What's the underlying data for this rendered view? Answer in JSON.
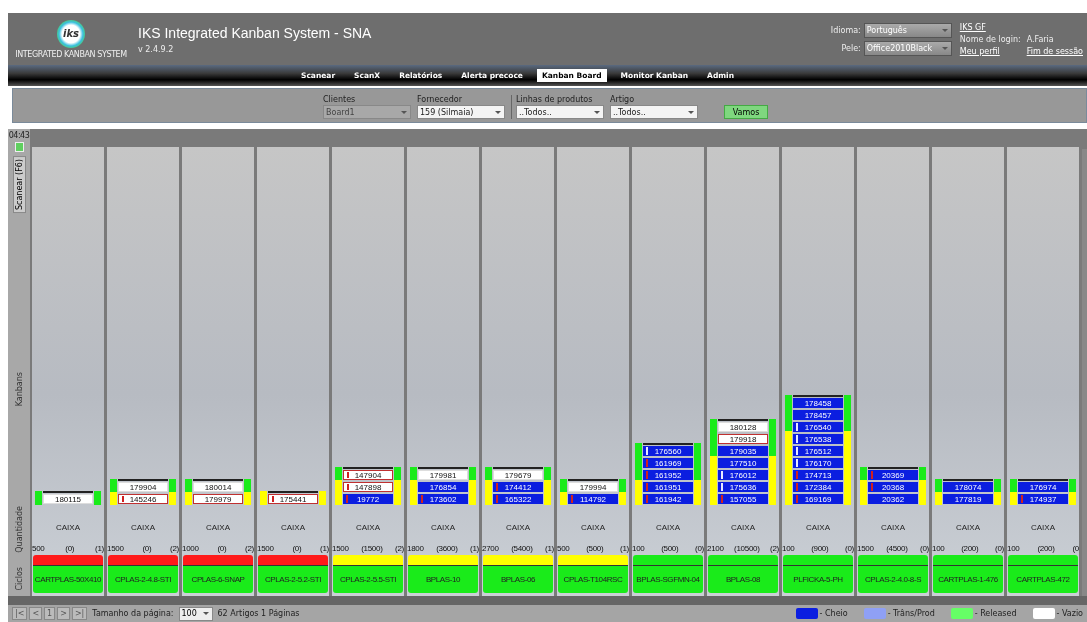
{
  "header": {
    "logo_text": "iks",
    "logo_caption": "INTEGRATED KANBAN SYSTEM",
    "title": "IKS Integrated Kanban System - SNA",
    "version": "v 2.4.9.2",
    "settings": [
      {
        "label": "Idioma:",
        "value": "Português"
      },
      {
        "label": "Pele:",
        "value": "Office2010Black"
      }
    ],
    "user": {
      "company_link": "IKS GF",
      "login_label": "Nome de login:",
      "login": "A.Faria",
      "profile_link": "Meu perfil",
      "logout_link": "Fim de sessão"
    }
  },
  "nav": [
    {
      "label": "Scanear",
      "selected": false
    },
    {
      "label": "ScanX",
      "selected": false
    },
    {
      "label": "Relatórios",
      "selected": false
    },
    {
      "label": "Alerta precoce",
      "selected": false
    },
    {
      "label": "Kanban Board",
      "selected": true
    },
    {
      "label": "Monitor Kanban",
      "selected": false
    },
    {
      "label": "Admin",
      "selected": false
    }
  ],
  "filters": [
    {
      "label": "Clientes",
      "value": "Board1",
      "disabled": true
    },
    {
      "label": "Fornecedor",
      "value": "159 (Silmaia)",
      "disabled": false
    },
    {
      "label": "Linhas de produtos",
      "value": "..Todos..",
      "disabled": false
    },
    {
      "label": "Artigo",
      "value": "..Todos..",
      "disabled": false
    }
  ],
  "go_button": "Vamos",
  "rail": {
    "time": "04:43",
    "scan_tab": "Scanear (F6)",
    "row_labels": [
      "Kanbans",
      "Quantidade",
      "Ciclos"
    ]
  },
  "columns": [
    {
      "name": "CARTPLAS-50X410",
      "unit": "CAIXA",
      "qty": "500",
      "demand": "(0)",
      "cycles": "(1)",
      "color": "#ff1a1a",
      "level": 1,
      "cards": [
        {
          "number": "180115",
          "kind": "empty",
          "flagged": false
        }
      ]
    },
    {
      "name": "CPLAS-2-4.8-STI",
      "unit": "CAIXA",
      "qty": "1500",
      "demand": "(0)",
      "cycles": "(2)",
      "color": "#ff1a1a",
      "level": 0.5,
      "cards": [
        {
          "number": "179904",
          "kind": "empty",
          "flagged": false
        },
        {
          "number": "145246",
          "kind": "empty",
          "flagged": true,
          "marker": {
            "color": "#d02020"
          }
        }
      ]
    },
    {
      "name": "CPLAS-6-SNAP",
      "unit": "CAIXA",
      "qty": "1000",
      "demand": "(0)",
      "cycles": "(2)",
      "color": "#ff1a1a",
      "level": 0.5,
      "cards": [
        {
          "number": "180014",
          "kind": "empty",
          "flagged": false
        },
        {
          "number": "179979",
          "kind": "empty",
          "flagged": true
        }
      ]
    },
    {
      "name": "CPLAS-2-5.2-STI",
      "unit": "CAIXA",
      "qty": "1500",
      "demand": "(0)",
      "cycles": "(1)",
      "color": "#ff1a1a",
      "level": 0,
      "cards": [
        {
          "number": "175441",
          "kind": "empty",
          "flagged": true,
          "marker": {
            "color": "#d02020"
          }
        }
      ]
    },
    {
      "name": "CPLAS-2-5.5-STI",
      "unit": "CAIXA",
      "qty": "1500",
      "demand": "(1500)",
      "cycles": "(2)",
      "color": "#ffff00",
      "level": 0.33,
      "cards": [
        {
          "number": "147904",
          "kind": "empty",
          "flagged": true,
          "marker": {
            "color": "#d02020"
          }
        },
        {
          "number": "147898",
          "kind": "empty",
          "flagged": true,
          "marker": {
            "color": "#d02020"
          }
        },
        {
          "number": "19772",
          "kind": "full",
          "flagged": false,
          "marker": {
            "color": "#d02020"
          }
        }
      ]
    },
    {
      "name": "BPLAS-10",
      "unit": "CAIXA",
      "qty": "1800",
      "demand": "(3600)",
      "cycles": "(1)",
      "color": "#ffff00",
      "level": 0.33,
      "cards": [
        {
          "number": "179981",
          "kind": "empty",
          "flagged": false
        },
        {
          "number": "176854",
          "kind": "full",
          "flagged": false
        },
        {
          "number": "173602",
          "kind": "full",
          "flagged": false,
          "marker": {
            "color": "#d02020"
          }
        }
      ]
    },
    {
      "name": "BPLAS-06",
      "unit": "CAIXA",
      "qty": "2700",
      "demand": "(5400)",
      "cycles": "(1)",
      "color": "#ffff00",
      "level": 0.33,
      "cards": [
        {
          "number": "179679",
          "kind": "empty",
          "flagged": false
        },
        {
          "number": "174412",
          "kind": "full",
          "flagged": false,
          "marker": {
            "color": "#d02020"
          }
        },
        {
          "number": "165322",
          "kind": "full",
          "flagged": false,
          "marker": {
            "color": "#d02020"
          }
        }
      ]
    },
    {
      "name": "CPLAS-T104RSC",
      "unit": "CAIXA",
      "qty": "500",
      "demand": "(500)",
      "cycles": "(1)",
      "color": "#ffff00",
      "level": 0.5,
      "cards": [
        {
          "number": "179994",
          "kind": "empty",
          "flagged": false
        },
        {
          "number": "114792",
          "kind": "full",
          "flagged": false,
          "marker": {
            "color": "#d02020"
          }
        }
      ]
    },
    {
      "name": "BPLAS-SGFMN-04",
      "unit": "CAIXA",
      "qty": "100",
      "demand": "(500)",
      "cycles": "(0)",
      "color": "#1aeb1a",
      "level": 0.6,
      "cards": [
        {
          "number": "176560",
          "kind": "full",
          "flagged": false,
          "marker": {
            "color": "#e8e8ff"
          }
        },
        {
          "number": "161969",
          "kind": "full",
          "flagged": false,
          "marker": {
            "color": "#d02020"
          }
        },
        {
          "number": "161952",
          "kind": "full",
          "flagged": false,
          "marker": {
            "color": "#d02020"
          }
        },
        {
          "number": "161951",
          "kind": "full",
          "flagged": false,
          "marker": {
            "color": "#d02020"
          }
        },
        {
          "number": "161942",
          "kind": "full",
          "flagged": false,
          "marker": {
            "color": "#d02020"
          }
        }
      ]
    },
    {
      "name": "BPLAS-08",
      "unit": "CAIXA",
      "qty": "2100",
      "demand": "(10500)",
      "cycles": "(2)",
      "color": "#1aeb1a",
      "level": 0.43,
      "cards": [
        {
          "number": "180128",
          "kind": "empty",
          "flagged": false
        },
        {
          "number": "179918",
          "kind": "empty",
          "flagged": true
        },
        {
          "number": "179035",
          "kind": "full",
          "flagged": false
        },
        {
          "number": "177510",
          "kind": "full",
          "flagged": false
        },
        {
          "number": "176012",
          "kind": "full",
          "flagged": false,
          "marker": {
            "color": "#e8e8ff"
          }
        },
        {
          "number": "175636",
          "kind": "full",
          "flagged": false,
          "marker": {
            "color": "#e8e8ff"
          }
        },
        {
          "number": "157055",
          "kind": "full",
          "flagged": false,
          "marker": {
            "color": "#d02020"
          }
        }
      ]
    },
    {
      "name": "PLFICKA-5-PH",
      "unit": "CAIXA",
      "qty": "100",
      "demand": "(900)",
      "cycles": "(0)",
      "color": "#1aeb1a",
      "level": 0.33,
      "cards": [
        {
          "number": "178458",
          "kind": "full",
          "flagged": false
        },
        {
          "number": "178457",
          "kind": "full",
          "flagged": false
        },
        {
          "number": "176540",
          "kind": "full",
          "flagged": false,
          "marker": {
            "color": "#e8e8ff"
          }
        },
        {
          "number": "176538",
          "kind": "full",
          "flagged": false,
          "marker": {
            "color": "#e8e8ff"
          }
        },
        {
          "number": "176512",
          "kind": "full",
          "flagged": false,
          "marker": {
            "color": "#e8e8ff"
          }
        },
        {
          "number": "176170",
          "kind": "full",
          "flagged": false,
          "marker": {
            "color": "#e8e8ff"
          }
        },
        {
          "number": "174713",
          "kind": "full",
          "flagged": false,
          "marker": {
            "color": "#d02020"
          }
        },
        {
          "number": "172384",
          "kind": "full",
          "flagged": false,
          "marker": {
            "color": "#d02020"
          }
        },
        {
          "number": "169169",
          "kind": "full",
          "flagged": false,
          "marker": {
            "color": "#d02020"
          }
        }
      ]
    },
    {
      "name": "CPLAS-2-4.0-8-S",
      "unit": "CAIXA",
      "qty": "1500",
      "demand": "(4500)",
      "cycles": "(0)",
      "color": "#1aeb1a",
      "level": 0.33,
      "cards": [
        {
          "number": "20369",
          "kind": "full",
          "flagged": false,
          "marker": {
            "color": "#d02020"
          }
        },
        {
          "number": "20368",
          "kind": "full",
          "flagged": false,
          "marker": {
            "color": "#d02020"
          }
        },
        {
          "number": "20362",
          "kind": "full",
          "flagged": false
        }
      ]
    },
    {
      "name": "CARTPLAS-1-476",
      "unit": "CAIXA",
      "qty": "100",
      "demand": "(200)",
      "cycles": "(0)",
      "color": "#1aeb1a",
      "level": 0.5,
      "cards": [
        {
          "number": "178074",
          "kind": "full",
          "flagged": false
        },
        {
          "number": "177819",
          "kind": "full",
          "flagged": false
        }
      ]
    },
    {
      "name": "CARTPLAS-472",
      "unit": "CAIXA",
      "qty": "100",
      "demand": "(200)",
      "cycles": "(0",
      "color": "#1aeb1a",
      "level": 0.5,
      "cards": [
        {
          "number": "176974",
          "kind": "full",
          "flagged": false
        },
        {
          "number": "174937",
          "kind": "full",
          "flagged": false,
          "marker": {
            "color": "#d02020"
          }
        }
      ]
    }
  ],
  "footer": {
    "pager": [
      "|<",
      "<",
      "1",
      ">",
      ">|"
    ],
    "page_size_label": "Tamanho da página:",
    "page_size": "100",
    "summary": "62 Artigos 1 Páginas",
    "legend": [
      {
        "label": "- Cheio",
        "color": "#0b1ee0"
      },
      {
        "label": "- Trâns/Prod",
        "color": "#8fa0f5"
      },
      {
        "label": "- Released",
        "color": "#66ff66"
      },
      {
        "label": "- Vazio",
        "color": "#ffffff"
      }
    ]
  }
}
